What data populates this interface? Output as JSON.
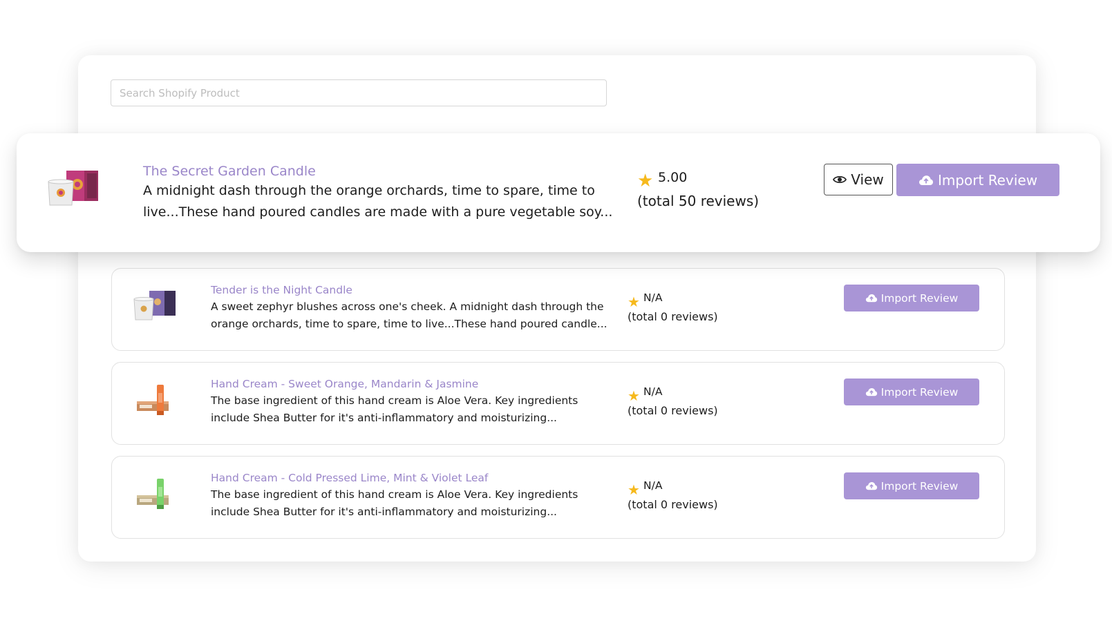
{
  "search": {
    "placeholder": "Search Shopify Product",
    "value": ""
  },
  "products": [
    {
      "title": "The Secret Garden Candle",
      "description": " A midnight dash through the orange orchards, time to spare, time to live...These hand poured candles are made with a pure vegetable soy...",
      "rating": "5.00",
      "reviews": "(total 50 reviews)",
      "view_label": "View",
      "import_label": "Import Review",
      "image": "candle-pink-box"
    },
    {
      "title": "Tender is the Night Candle",
      "description": "A sweet zephyr blushes across one's cheek. A midnight dash through the orange orchards, time to spare, time to live...These hand poured candle...",
      "rating": "N/A",
      "reviews": "(total 0 reviews)",
      "import_label": "Import Review",
      "image": "candle-purple-box"
    },
    {
      "title": "Hand Cream - Sweet Orange, Mandarin & Jasmine",
      "description": "The base ingredient of this hand cream is Aloe Vera. Key ingredients include Shea Butter for it's anti-inflammatory and moisturizing...",
      "rating": "N/A",
      "reviews": "(total 0 reviews)",
      "import_label": "Import Review",
      "image": "hand-cream-orange-tube"
    },
    {
      "title": "Hand Cream - Cold Pressed Lime, Mint & Violet Leaf",
      "description": "The base ingredient of this hand cream is Aloe Vera. Key ingredients include Shea Butter for it's anti-inflammatory and moisturizing...",
      "rating": "N/A",
      "reviews": "(total 0 reviews)",
      "import_label": "Import Review",
      "image": "hand-cream-green-tube"
    }
  ],
  "colors": {
    "accent": "#a995d6",
    "title": "#9a86c9",
    "star": "#f6b91c"
  },
  "icons": {
    "star": "star-icon",
    "view": "eye-icon",
    "import": "cloud-upload-icon"
  }
}
